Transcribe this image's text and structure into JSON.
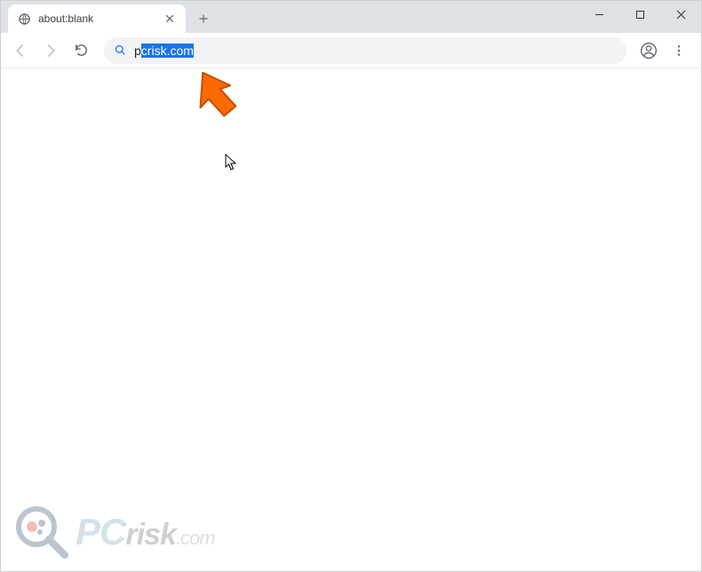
{
  "tab": {
    "title": "about:blank",
    "favicon": "globe-icon"
  },
  "toolbar": {
    "back_enabled": false,
    "forward_enabled": false
  },
  "omnibox": {
    "typed": "p",
    "autocomplete": "crisk.com"
  },
  "window": {
    "minimize": "–",
    "maximize": "□",
    "close": "×"
  },
  "watermark": {
    "pc": "PC",
    "risk": "risk",
    "ext": ".com"
  },
  "overlay": {
    "arrow_color": "#ff6a00"
  }
}
